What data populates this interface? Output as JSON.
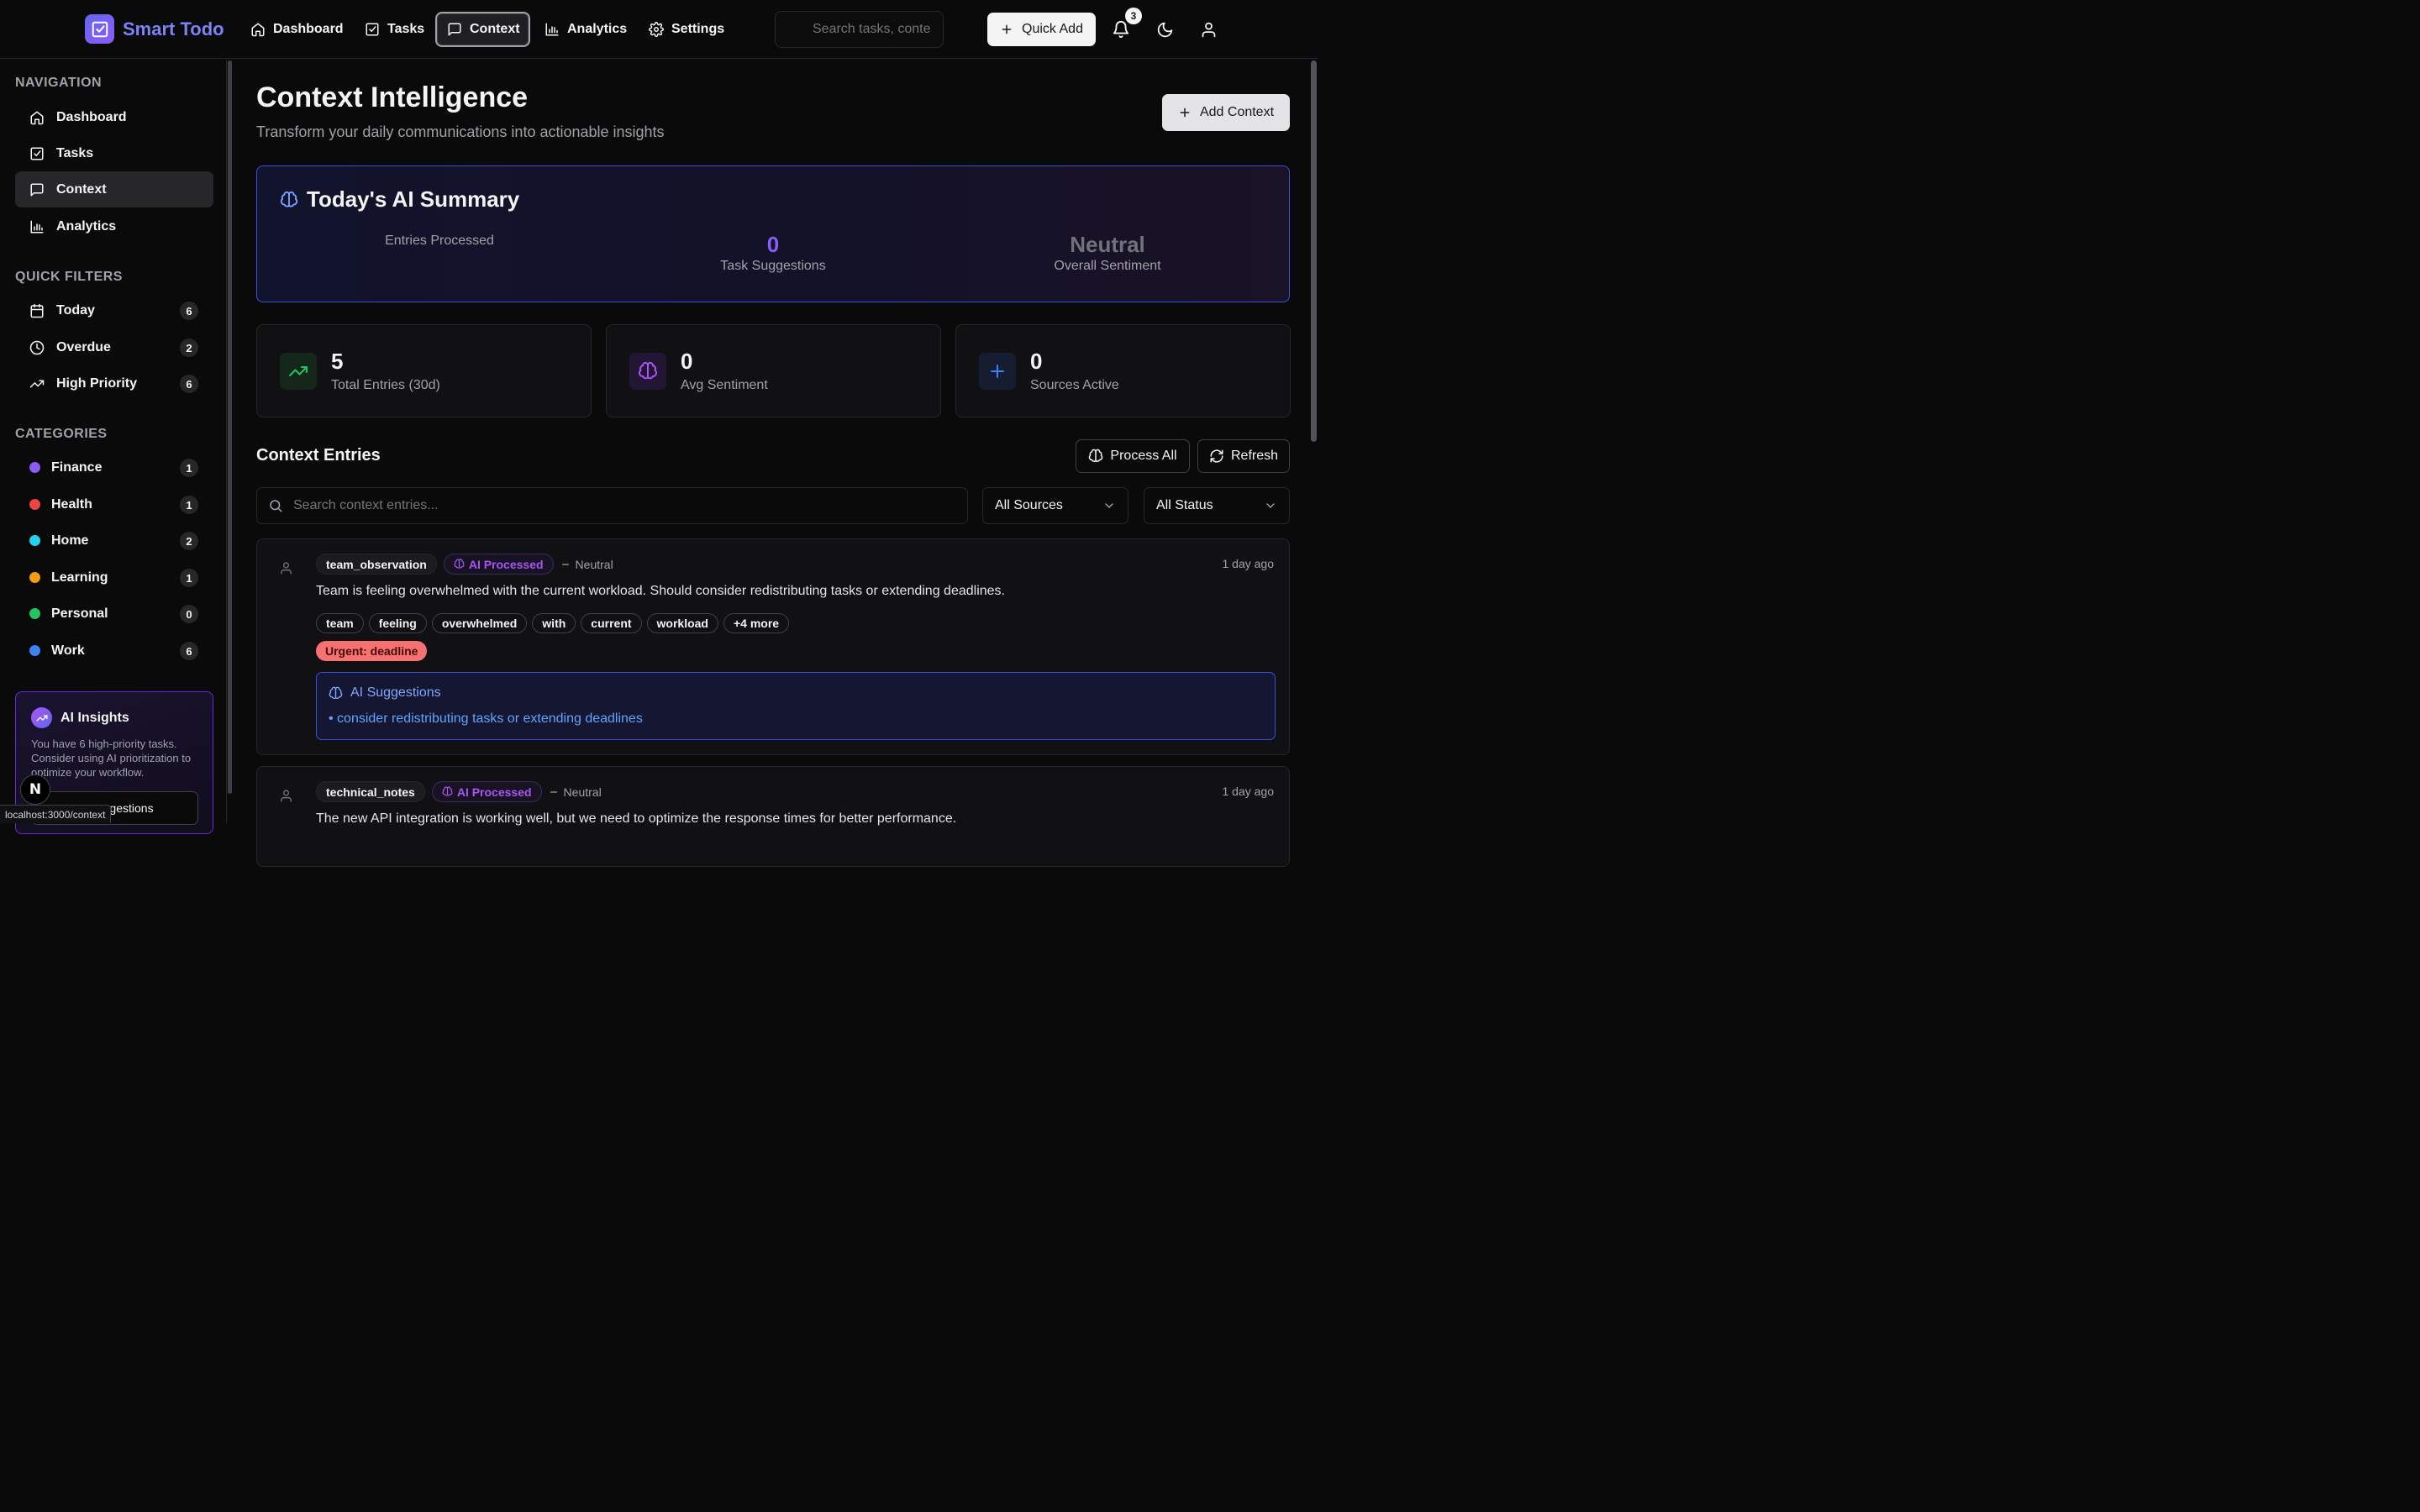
{
  "brand": {
    "name": "Smart Todo"
  },
  "nav": {
    "links": [
      {
        "label": "Dashboard",
        "icon": "home-icon"
      },
      {
        "label": "Tasks",
        "icon": "checkbox-icon"
      },
      {
        "label": "Context",
        "icon": "message-square-icon",
        "active": true
      },
      {
        "label": "Analytics",
        "icon": "bar-chart-icon"
      },
      {
        "label": "Settings",
        "icon": "gear-icon"
      }
    ],
    "search_placeholder": "Search tasks, conte",
    "quick_add": "Quick Add",
    "notification_count": "3"
  },
  "sidebar": {
    "navigation_heading": "NAVIGATION",
    "navigation": [
      {
        "label": "Dashboard",
        "icon": "home-icon"
      },
      {
        "label": "Tasks",
        "icon": "checkbox-icon"
      },
      {
        "label": "Context",
        "icon": "message-square-icon",
        "active": true
      },
      {
        "label": "Analytics",
        "icon": "bar-chart-icon"
      }
    ],
    "filters_heading": "QUICK FILTERS",
    "filters": [
      {
        "label": "Today",
        "count": "6",
        "icon": "calendar-icon"
      },
      {
        "label": "Overdue",
        "count": "2",
        "icon": "clock-icon"
      },
      {
        "label": "High Priority",
        "count": "6",
        "icon": "trending-up-icon"
      }
    ],
    "categories_heading": "CATEGORIES",
    "categories": [
      {
        "label": "Finance",
        "count": "1",
        "color": "#8b5cf6"
      },
      {
        "label": "Health",
        "count": "1",
        "color": "#ef4444"
      },
      {
        "label": "Home",
        "count": "2",
        "color": "#22d3ee"
      },
      {
        "label": "Learning",
        "count": "1",
        "color": "#f59e0b"
      },
      {
        "label": "Personal",
        "count": "0",
        "color": "#22c55e"
      },
      {
        "label": "Work",
        "count": "6",
        "color": "#3b82f6"
      }
    ],
    "ai_insights": {
      "title": "AI Insights",
      "text": "You have 6 high-priority tasks. Consider using AI prioritization to optimize your workflow.",
      "button": "gestions"
    }
  },
  "status_url": "localhost:3000/context",
  "page": {
    "title": "Context Intelligence",
    "subtitle": "Transform your daily communications into actionable insights",
    "add_context": "Add Context"
  },
  "summary": {
    "title": "Today's AI Summary",
    "entries_processed_label": "Entries Processed",
    "entries_processed_value": "",
    "task_suggestions_value": "0",
    "task_suggestions_label": "Task Suggestions",
    "sentiment_value": "Neutral",
    "sentiment_label": "Overall Sentiment"
  },
  "stats": [
    {
      "value": "5",
      "label": "Total Entries (30d)",
      "icon": "trending-up-icon",
      "color": "#22c55e"
    },
    {
      "value": "0",
      "label": "Avg Sentiment",
      "icon": "brain-icon",
      "color": "#a855f7"
    },
    {
      "value": "0",
      "label": "Sources Active",
      "icon": "plus-icon",
      "color": "#3b82f6"
    }
  ],
  "entries_section": {
    "title": "Context Entries",
    "process_all": "Process All",
    "refresh": "Refresh",
    "search_placeholder": "Search context entries...",
    "source_filter": "All Sources",
    "status_filter": "All Status"
  },
  "entries": [
    {
      "source": "team_observation",
      "ai_badge": "AI Processed",
      "sentiment": "Neutral",
      "time": "1 day ago",
      "text": "Team is feeling overwhelmed with the current workload. Should consider redistributing tasks or extending deadlines.",
      "tags": [
        "team",
        "feeling",
        "overwhelmed",
        "with",
        "current",
        "workload",
        "+4 more"
      ],
      "urgent": "Urgent: deadline",
      "suggestions_title": "AI Suggestions",
      "suggestions": [
        "• consider redistributing tasks or extending deadlines"
      ]
    },
    {
      "source": "technical_notes",
      "ai_badge": "AI Processed",
      "sentiment": "Neutral",
      "time": "1 day ago",
      "text": "The new API integration is working well, but we need to optimize the response times for better performance."
    }
  ]
}
